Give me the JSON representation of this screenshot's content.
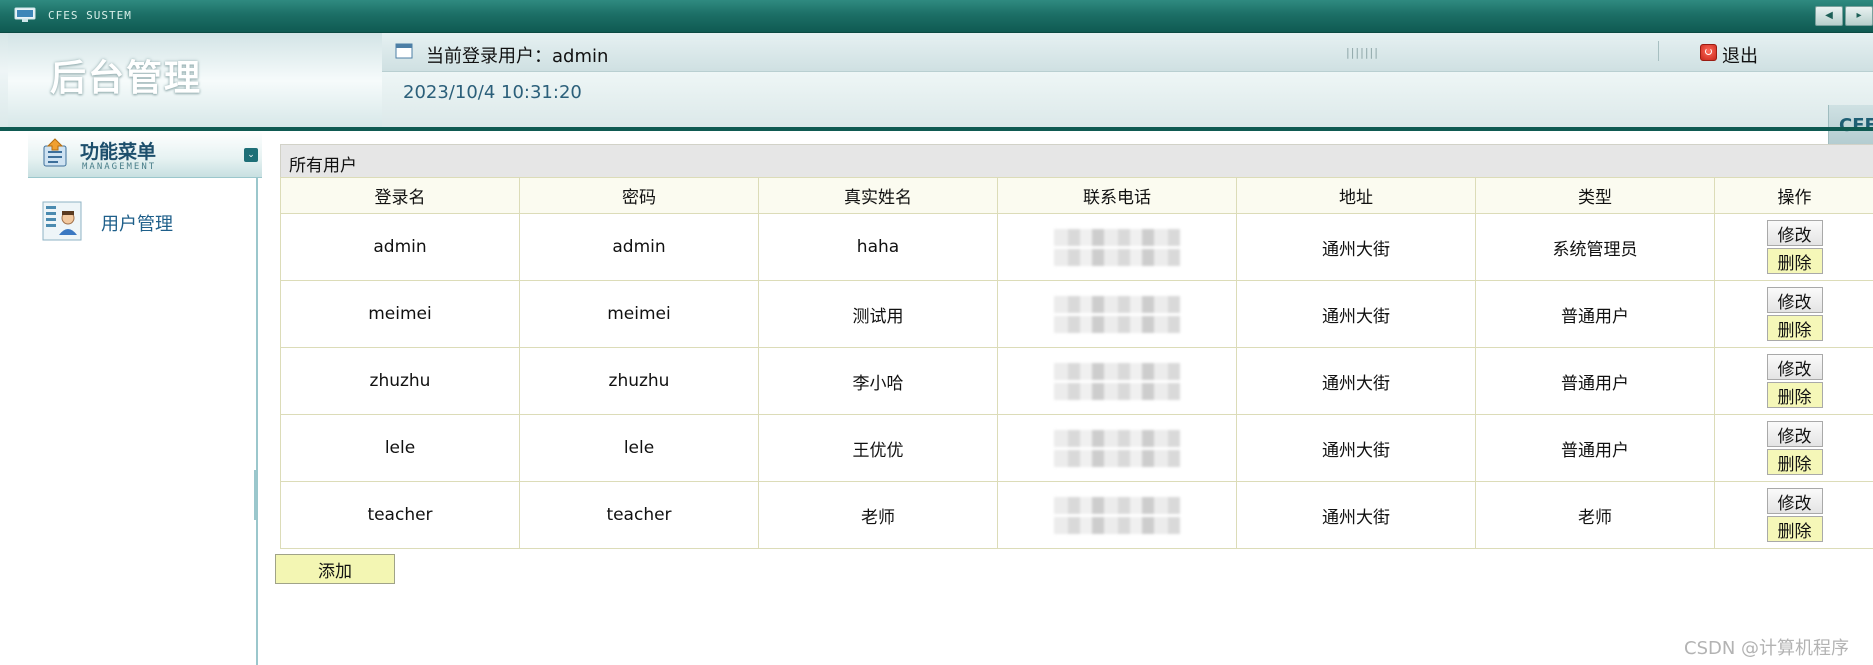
{
  "window": {
    "system_name": "CFES SUSTEM"
  },
  "header": {
    "brand_title": "后台管理",
    "current_user_label": "当前登录用户：admin",
    "datetime": "2023/10/4 10:31:20",
    "logout_label": "退出",
    "logo_stub": "CFE"
  },
  "sidebar": {
    "menu_title": "功能菜单",
    "menu_subtitle": "MANAGEMENT",
    "items": [
      {
        "label": "用户管理",
        "icon": "user-management-icon"
      }
    ]
  },
  "content": {
    "panel_title": "所有用户",
    "columns": [
      "登录名",
      "密码",
      "真实姓名",
      "联系电话",
      "地址",
      "类型",
      "操作"
    ],
    "rows": [
      {
        "login": "admin",
        "password": "admin",
        "real_name": "haha",
        "address": "通州大街",
        "type": "系统管理员"
      },
      {
        "login": "meimei",
        "password": "meimei",
        "real_name": "测试用",
        "address": "通州大街",
        "type": "普通用户"
      },
      {
        "login": "zhuzhu",
        "password": "zhuzhu",
        "real_name": "李小哈",
        "address": "通州大街",
        "type": "普通用户"
      },
      {
        "login": "lele",
        "password": "lele",
        "real_name": "王优优",
        "address": "通州大街",
        "type": "普通用户"
      },
      {
        "login": "teacher",
        "password": "teacher",
        "real_name": "老师",
        "address": "通州大街",
        "type": "老师"
      }
    ],
    "edit_label": "修改",
    "delete_label": "删除",
    "add_label": "添加"
  },
  "watermark": "CSDN @计算机程序",
  "colors": {
    "titlebar": "#1c6f66",
    "accent_teal": "#0f5a52",
    "delete_button": "#f5f7b8",
    "table_border": "#dcdcb8"
  }
}
